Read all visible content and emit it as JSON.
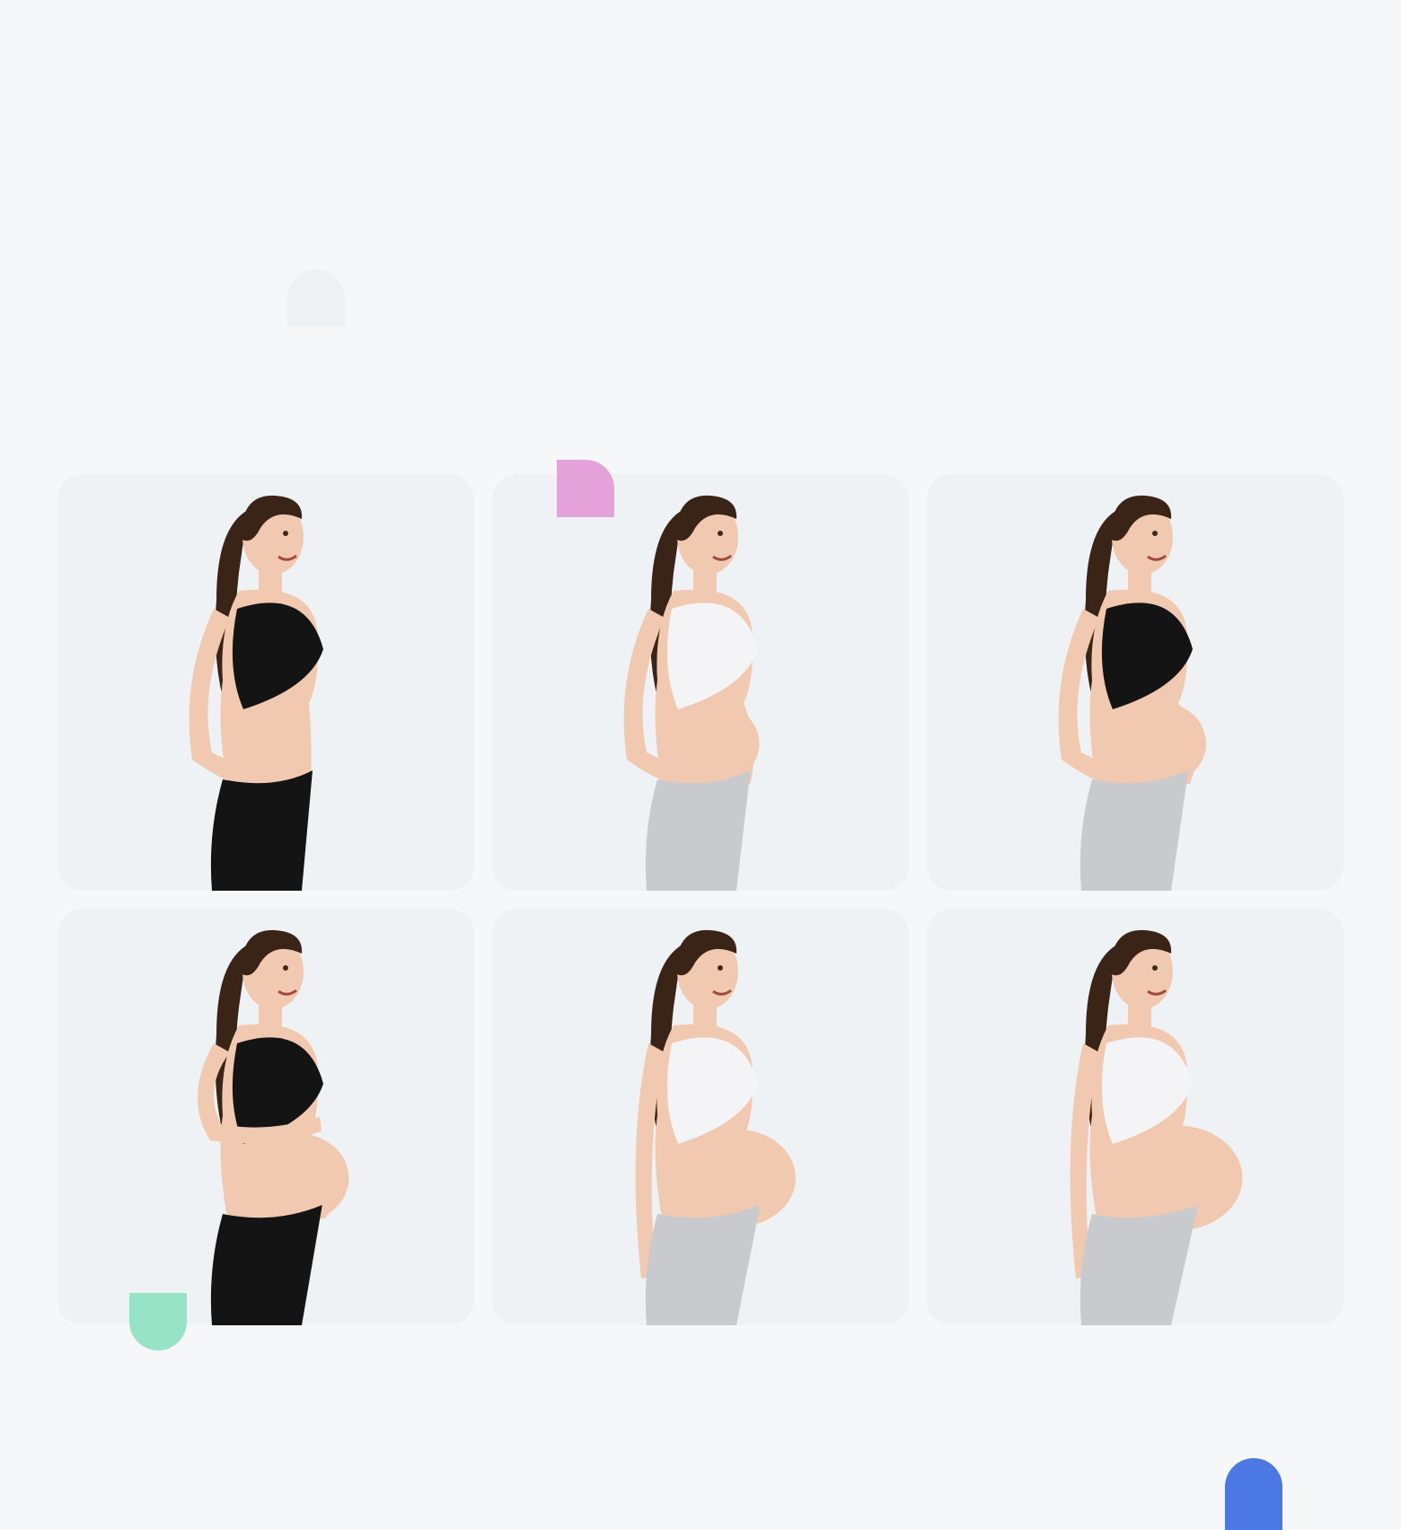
{
  "gallery": {
    "items": [
      {
        "top": "black",
        "bottom": "black",
        "belly": 0,
        "hands": "hips"
      },
      {
        "top": "white",
        "bottom": "gray",
        "belly": 1,
        "hands": "hips"
      },
      {
        "top": "black",
        "bottom": "gray",
        "belly": 2,
        "hands": "hips"
      },
      {
        "top": "black",
        "bottom": "black",
        "belly": 3,
        "hands": "belly"
      },
      {
        "top": "white",
        "bottom": "gray",
        "belly": 4,
        "hands": "side"
      },
      {
        "top": "white",
        "bottom": "gray",
        "belly": 5,
        "hands": "side"
      }
    ]
  },
  "colors": {
    "page_bg": "#f6f7f9",
    "card_bg": "#eff2f5",
    "skin": "#f1c9b0",
    "hair": "#3a2418",
    "black_wear": "#141414",
    "white_wear": "#f4f4f6",
    "gray_wear": "#c9cacd",
    "accent_pink": "#e3a3d9",
    "accent_green": "#96e3c6",
    "accent_blue": "#4c78e3"
  }
}
